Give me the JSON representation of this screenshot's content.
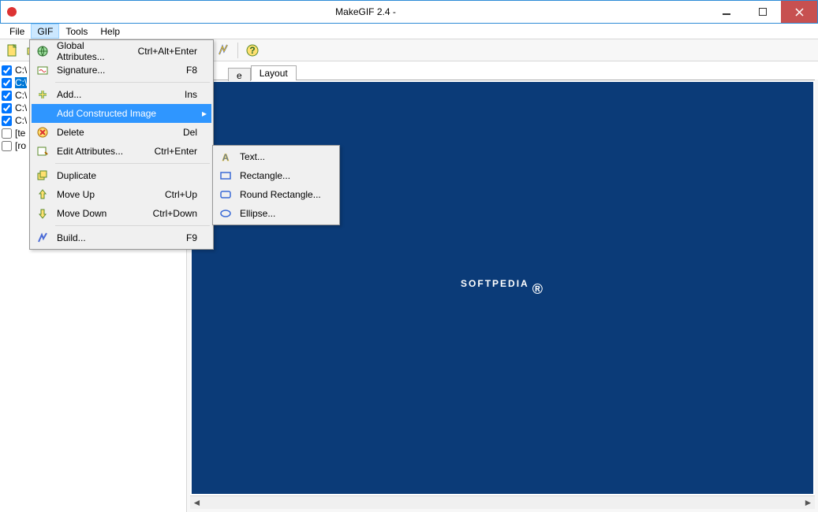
{
  "window": {
    "title": "MakeGIF 2.4 -"
  },
  "menubar": [
    "File",
    "GIF",
    "Tools",
    "Help"
  ],
  "menubar_open_index": 1,
  "toolbar_icons": [
    "new-file-icon",
    "open-file-icon",
    "save-icon",
    "sep",
    "add-image-icon",
    "delete-image-icon",
    "attributes-icon",
    "sep",
    "duplicate-icon",
    "move-up-icon",
    "move-down-icon",
    "sep",
    "build-icon",
    "sep",
    "help-icon"
  ],
  "files": [
    {
      "checked": true,
      "selected": false,
      "label": "C:\\"
    },
    {
      "checked": true,
      "selected": true,
      "label": "C:\\"
    },
    {
      "checked": true,
      "selected": false,
      "label": "C:\\"
    },
    {
      "checked": true,
      "selected": false,
      "label": "C:\\"
    },
    {
      "checked": true,
      "selected": false,
      "label": "C:\\"
    },
    {
      "checked": false,
      "selected": false,
      "label": "[te"
    },
    {
      "checked": false,
      "selected": false,
      "label": "[ro"
    }
  ],
  "tabs": {
    "hidden_partial": "e",
    "active": "Layout"
  },
  "preview_brand": "SOFTPEDIA",
  "gif_menu": [
    {
      "icon": "globe-icon",
      "label": "Global Attributes...",
      "shortcut": "Ctrl+Alt+Enter"
    },
    {
      "icon": "signature-icon",
      "label": "Signature...",
      "shortcut": "F8"
    },
    {
      "sep": true
    },
    {
      "icon": "add-icon",
      "label": "Add...",
      "shortcut": "Ins"
    },
    {
      "icon": "",
      "label": "Add Constructed Image",
      "submenu": true,
      "highlight": true
    },
    {
      "icon": "delete-x-icon",
      "label": "Delete",
      "shortcut": "Del"
    },
    {
      "icon": "edit-attr-icon",
      "label": "Edit Attributes...",
      "shortcut": "Ctrl+Enter"
    },
    {
      "sep": true
    },
    {
      "icon": "duplicate-icon",
      "label": "Duplicate"
    },
    {
      "icon": "move-up-icon",
      "label": "Move Up",
      "shortcut": "Ctrl+Up"
    },
    {
      "icon": "move-down-icon",
      "label": "Move Down",
      "shortcut": "Ctrl+Down"
    },
    {
      "sep": true
    },
    {
      "icon": "build-icon",
      "label": "Build...",
      "shortcut": "F9"
    }
  ],
  "submenu": [
    {
      "icon": "text-a-icon",
      "label": "Text..."
    },
    {
      "icon": "rectangle-icon",
      "label": "Rectangle..."
    },
    {
      "icon": "round-rect-icon",
      "label": "Round Rectangle..."
    },
    {
      "icon": "ellipse-icon",
      "label": "Ellipse..."
    }
  ]
}
